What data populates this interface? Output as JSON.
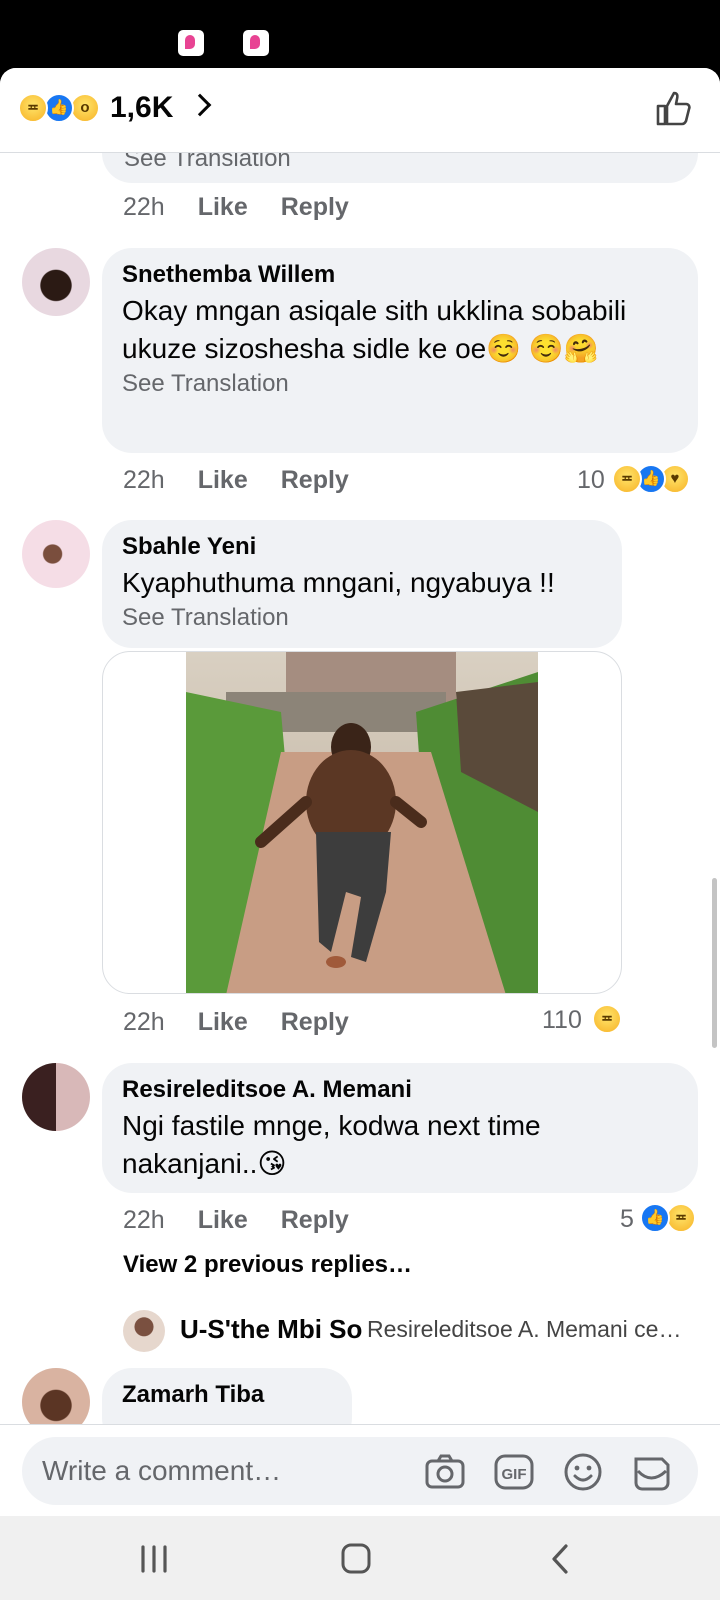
{
  "reactions": {
    "count": "1,6K"
  },
  "comments": [
    {
      "see_translation": "See Translation",
      "time": "22h",
      "like": "Like",
      "reply": "Reply"
    },
    {
      "author": "Snethemba Willem",
      "text": "Okay mngan asiqale sith ukklina sobabili ukuze sizoshesha sidle ke oe☺️ ☺️🤗",
      "see_translation": "See Translation",
      "time": "22h",
      "like": "Like",
      "reply": "Reply",
      "reaction_count": "10"
    },
    {
      "author": "Sbahle Yeni",
      "text": "Kyaphuthuma mngani, ngyabuya !!",
      "see_translation": "See Translation",
      "time": "22h",
      "like": "Like",
      "reply": "Reply",
      "reaction_count": "110"
    },
    {
      "author": "Resireleditsoe A. Memani",
      "text": "Ngi fastile mnge, kodwa  next time nakanjani..😘",
      "time": "22h",
      "like": "Like",
      "reply": "Reply",
      "reaction_count": "5"
    },
    {
      "author": "Zamarh Tiba"
    }
  ],
  "replies": {
    "view_previous": "View 2 previous replies…",
    "preview_author": "U-S'the Mbi So",
    "preview_text": "Resireleditsoe A. Memani ce…"
  },
  "composer": {
    "placeholder": "Write a comment…"
  }
}
